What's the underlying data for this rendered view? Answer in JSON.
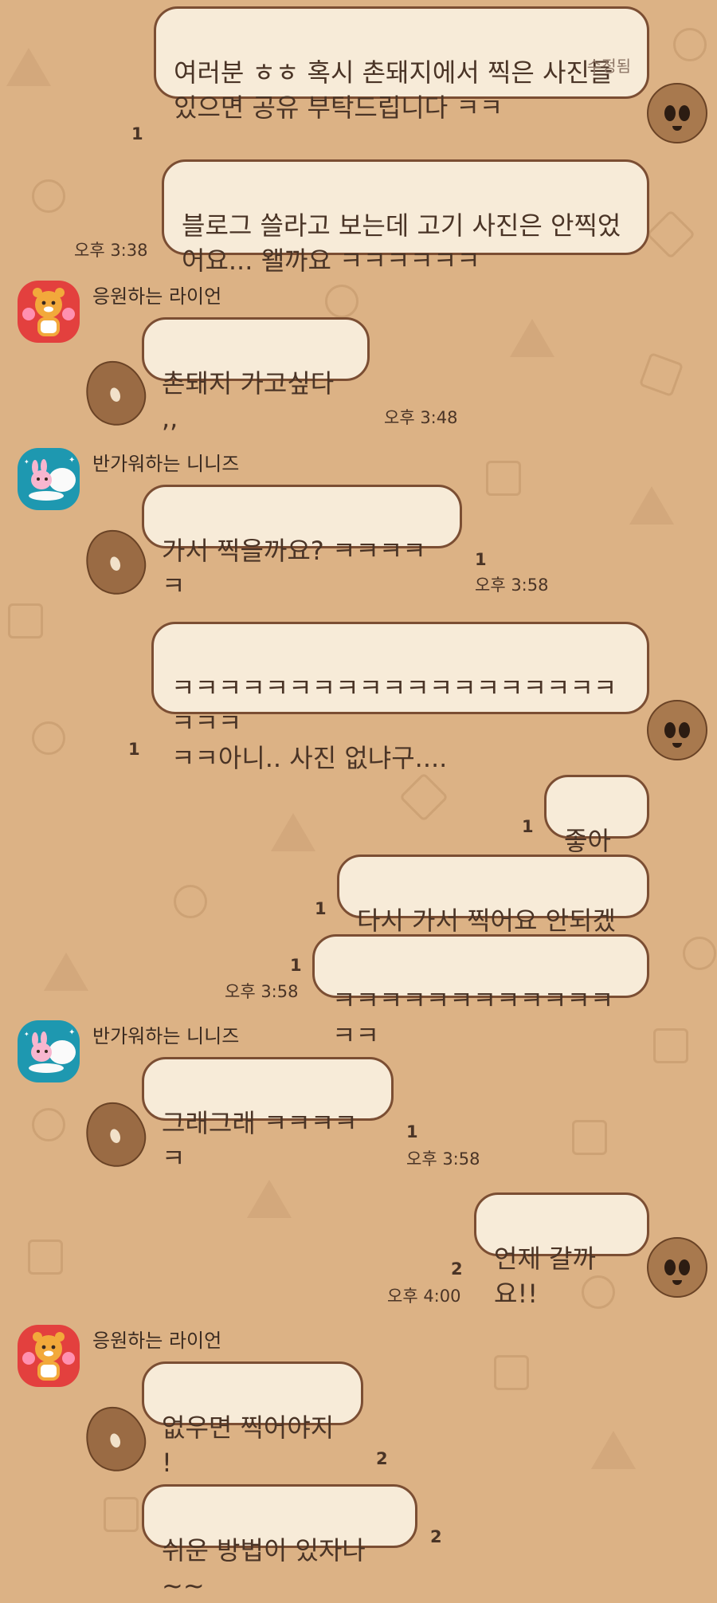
{
  "messages": {
    "m1": {
      "text": "여러분 ㅎㅎ 혹시 촌돼지에서 찍은 사진들 있으면 공유 부탁드립니다 ㅋㅋ",
      "edited": "수정됨"
    },
    "m1_unread": "1",
    "m2": {
      "text": "블로그 쓸라고 보는데 고기 사진은 안찍었어요... 왤까요 ㅋㅋㅋㅋㅋㅋ",
      "time": "오후 3:38"
    },
    "m3": {
      "sender": "응원하는 라이언",
      "text": "촌돼지 가고싶다 ,,",
      "time": "오후 3:48"
    },
    "m4": {
      "sender": "반가워하는 니니즈",
      "text": "가서 찍을까요? ㅋㅋㅋㅋㅋ",
      "unread": "1",
      "time": "오후 3:58"
    },
    "m5": {
      "text": "ㅋㅋㅋㅋㅋㅋㅋㅋㅋㅋㅋㅋㅋㅋㅋㅋㅋㅋㅋㅋㅋㅋ\nㅋㅋ아니.. 사진 없냐구....",
      "unread": "1"
    },
    "m6": {
      "text": "좋아요",
      "unread": "1"
    },
    "m7": {
      "text": "다시 가서 찍어요 안되겠다",
      "unread": "1"
    },
    "m8": {
      "text": "ㅋㅋㅋㅋㅋㅋㅋㅋㅋㅋㅋㅋㅋㅋ",
      "unread": "1",
      "time": "오후 3:58"
    },
    "m9": {
      "sender": "반가워하는 니니즈",
      "text": "그래그래 ㅋㅋㅋㅋㅋ",
      "unread": "1",
      "time": "오후 3:58"
    },
    "m10": {
      "text": "언제 갈까요!!",
      "unread": "2",
      "time": "오후 4:00"
    },
    "m11": {
      "sender": "응원하는 라이언",
      "text": "없우면 찍어야지 !",
      "unread": "2"
    },
    "m12": {
      "text": "쉬운 방법이 있자나 ~~",
      "unread": "2"
    }
  },
  "icons": {
    "lion_avatar": "lion-avatar",
    "ninini_avatar": "ninini-avatar",
    "potato_sticker": "potato-icon",
    "potato_face": "potato-face-icon"
  },
  "colors": {
    "background": "#dcb285",
    "bubble_fill": "#f7ebd8",
    "bubble_border": "#7b4e33",
    "lion_avatar": "#e3403e",
    "ninini_avatar": "#1e98b0"
  }
}
